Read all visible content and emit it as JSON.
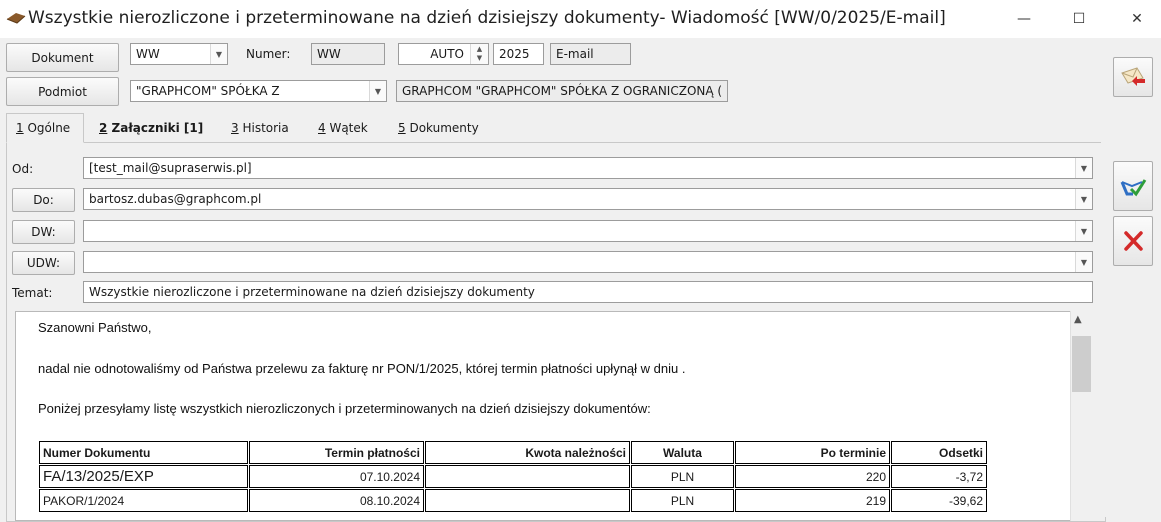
{
  "window": {
    "title": "Wszystkie nierozliczone i przeterminowane na dzień dzisiejszy dokumenty- Wiadomość [WW/0/2025/E-mail]",
    "minimize": "—",
    "maximize": "☐",
    "close": "✕"
  },
  "header": {
    "dokument_btn": "Dokument",
    "dokument_type": "WW",
    "numer_label": "Numer:",
    "numer_prefix": "WW",
    "numer_auto": "AUTO",
    "numer_year": "2025",
    "numer_suffix": "E-mail",
    "podmiot_btn": "Podmiot",
    "podmiot_code": "\"GRAPHCOM\" SPÓŁKA Z",
    "podmiot_name": "GRAPHCOM \"GRAPHCOM\" SPÓŁKA Z OGRANICZONĄ ("
  },
  "tabs": [
    {
      "num": "1",
      "label": " Ogólne"
    },
    {
      "num": "2",
      "label": " Załączniki [1]"
    },
    {
      "num": "3",
      "label": " Historia"
    },
    {
      "num": "4",
      "label": " Wątek"
    },
    {
      "num": "5",
      "label": " Dokumenty"
    }
  ],
  "form": {
    "od_label": "Od:",
    "od_value": "[test_mail@supraserwis.pl]",
    "do_btn": "Do:",
    "do_value": "bartosz.dubas@graphcom.pl",
    "dw_btn": "DW:",
    "dw_value": "",
    "udw_btn": "UDW:",
    "udw_value": "",
    "temat_label": "Temat:",
    "temat_value": "Wszystkie nierozliczone i przeterminowane na dzień dzisiejszy dokumenty"
  },
  "message": {
    "greeting": "Szanowni Państwo,",
    "line1": "nadal nie odnotowaliśmy od Państwa przelewu za fakturę nr PON/1/2025, której termin płatności upłynął w dniu .",
    "line2": "Poniżej przesyłamy listę wszystkich nierozliczonych i przeterminowanych na dzień dzisiejszy dokumentów:"
  },
  "table": {
    "headers": [
      "Numer Dokumentu",
      "Termin płatności",
      "Kwota należności",
      "Waluta",
      "Po terminie",
      "Odsetki"
    ],
    "rows": [
      [
        "FA/13/2025/EXP",
        "07.10.2024",
        "",
        "PLN",
        "220",
        "-3,72"
      ],
      [
        "PAKOR/1/2024",
        "08.10.2024",
        "",
        "PLN",
        "219",
        "-39,62"
      ]
    ]
  },
  "colors": {
    "accent_red": "#d42a2a",
    "accent_blue": "#2f6fc4"
  },
  "icons": {
    "app": "envelope-icon",
    "send": "send-mail-icon",
    "save": "save-check-icon",
    "cancel": "red-x-icon"
  }
}
